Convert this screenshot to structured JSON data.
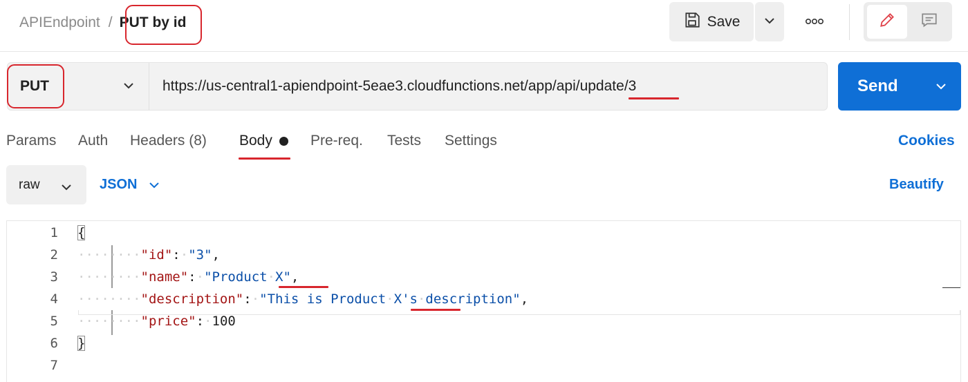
{
  "header": {
    "breadcrumb_parent": "APIEndpoint",
    "breadcrumb_separator": "/",
    "request_name": "PUT by id",
    "save_label": "Save"
  },
  "request": {
    "method": "PUT",
    "url_prefix": "https://us-central1-apiendpoint-5eae3.cloudfunctions.net/app/api/",
    "url_segment": "update",
    "url_suffix": "/3",
    "send_label": "Send"
  },
  "tabs": [
    {
      "label": "Params"
    },
    {
      "label": "Auth"
    },
    {
      "label": "Headers (8)"
    },
    {
      "label": "Body",
      "active": true
    },
    {
      "label": "Pre-req."
    },
    {
      "label": "Tests"
    },
    {
      "label": "Settings"
    }
  ],
  "cookies_label": "Cookies",
  "body_toolbar": {
    "mode": "raw",
    "language": "JSON",
    "beautify_label": "Beautify"
  },
  "editor": {
    "line_numbers": [
      "1",
      "2",
      "3",
      "4",
      "5",
      "6",
      "7"
    ],
    "open_brace": "{",
    "close_brace": "}",
    "fields": [
      {
        "key": "\"id\"",
        "value": "\"3\"",
        "comma": ","
      },
      {
        "key": "\"name\"",
        "value_pre": "\"Product",
        "value_mark": "X\"",
        "comma": ","
      },
      {
        "key": "\"description\"",
        "value_pre": "\"This is Product",
        "value_mark": "X's",
        "value_post": "description\"",
        "comma": ","
      },
      {
        "key": "\"price\"",
        "value": "100",
        "comma": ""
      }
    ]
  },
  "colors": {
    "accent": "#0f6fd6",
    "annotation": "#d8262d",
    "json_key": "#a31515",
    "json_string": "#0b4fa8"
  },
  "icons": [
    "save-icon",
    "chevron-down-icon",
    "more-options-icon",
    "pencil-icon",
    "comment-icon"
  ]
}
